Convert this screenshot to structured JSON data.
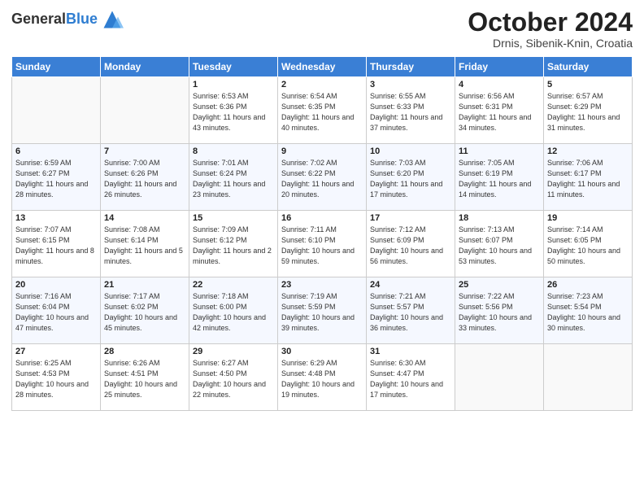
{
  "header": {
    "logo_general": "General",
    "logo_blue": "Blue",
    "month_title": "October 2024",
    "location": "Drnis, Sibenik-Knin, Croatia"
  },
  "days_of_week": [
    "Sunday",
    "Monday",
    "Tuesday",
    "Wednesday",
    "Thursday",
    "Friday",
    "Saturday"
  ],
  "weeks": [
    [
      {
        "day": "",
        "info": ""
      },
      {
        "day": "",
        "info": ""
      },
      {
        "day": "1",
        "info": "Sunrise: 6:53 AM\nSunset: 6:36 PM\nDaylight: 11 hours and 43 minutes."
      },
      {
        "day": "2",
        "info": "Sunrise: 6:54 AM\nSunset: 6:35 PM\nDaylight: 11 hours and 40 minutes."
      },
      {
        "day": "3",
        "info": "Sunrise: 6:55 AM\nSunset: 6:33 PM\nDaylight: 11 hours and 37 minutes."
      },
      {
        "day": "4",
        "info": "Sunrise: 6:56 AM\nSunset: 6:31 PM\nDaylight: 11 hours and 34 minutes."
      },
      {
        "day": "5",
        "info": "Sunrise: 6:57 AM\nSunset: 6:29 PM\nDaylight: 11 hours and 31 minutes."
      }
    ],
    [
      {
        "day": "6",
        "info": "Sunrise: 6:59 AM\nSunset: 6:27 PM\nDaylight: 11 hours and 28 minutes."
      },
      {
        "day": "7",
        "info": "Sunrise: 7:00 AM\nSunset: 6:26 PM\nDaylight: 11 hours and 26 minutes."
      },
      {
        "day": "8",
        "info": "Sunrise: 7:01 AM\nSunset: 6:24 PM\nDaylight: 11 hours and 23 minutes."
      },
      {
        "day": "9",
        "info": "Sunrise: 7:02 AM\nSunset: 6:22 PM\nDaylight: 11 hours and 20 minutes."
      },
      {
        "day": "10",
        "info": "Sunrise: 7:03 AM\nSunset: 6:20 PM\nDaylight: 11 hours and 17 minutes."
      },
      {
        "day": "11",
        "info": "Sunrise: 7:05 AM\nSunset: 6:19 PM\nDaylight: 11 hours and 14 minutes."
      },
      {
        "day": "12",
        "info": "Sunrise: 7:06 AM\nSunset: 6:17 PM\nDaylight: 11 hours and 11 minutes."
      }
    ],
    [
      {
        "day": "13",
        "info": "Sunrise: 7:07 AM\nSunset: 6:15 PM\nDaylight: 11 hours and 8 minutes."
      },
      {
        "day": "14",
        "info": "Sunrise: 7:08 AM\nSunset: 6:14 PM\nDaylight: 11 hours and 5 minutes."
      },
      {
        "day": "15",
        "info": "Sunrise: 7:09 AM\nSunset: 6:12 PM\nDaylight: 11 hours and 2 minutes."
      },
      {
        "day": "16",
        "info": "Sunrise: 7:11 AM\nSunset: 6:10 PM\nDaylight: 10 hours and 59 minutes."
      },
      {
        "day": "17",
        "info": "Sunrise: 7:12 AM\nSunset: 6:09 PM\nDaylight: 10 hours and 56 minutes."
      },
      {
        "day": "18",
        "info": "Sunrise: 7:13 AM\nSunset: 6:07 PM\nDaylight: 10 hours and 53 minutes."
      },
      {
        "day": "19",
        "info": "Sunrise: 7:14 AM\nSunset: 6:05 PM\nDaylight: 10 hours and 50 minutes."
      }
    ],
    [
      {
        "day": "20",
        "info": "Sunrise: 7:16 AM\nSunset: 6:04 PM\nDaylight: 10 hours and 47 minutes."
      },
      {
        "day": "21",
        "info": "Sunrise: 7:17 AM\nSunset: 6:02 PM\nDaylight: 10 hours and 45 minutes."
      },
      {
        "day": "22",
        "info": "Sunrise: 7:18 AM\nSunset: 6:00 PM\nDaylight: 10 hours and 42 minutes."
      },
      {
        "day": "23",
        "info": "Sunrise: 7:19 AM\nSunset: 5:59 PM\nDaylight: 10 hours and 39 minutes."
      },
      {
        "day": "24",
        "info": "Sunrise: 7:21 AM\nSunset: 5:57 PM\nDaylight: 10 hours and 36 minutes."
      },
      {
        "day": "25",
        "info": "Sunrise: 7:22 AM\nSunset: 5:56 PM\nDaylight: 10 hours and 33 minutes."
      },
      {
        "day": "26",
        "info": "Sunrise: 7:23 AM\nSunset: 5:54 PM\nDaylight: 10 hours and 30 minutes."
      }
    ],
    [
      {
        "day": "27",
        "info": "Sunrise: 6:25 AM\nSunset: 4:53 PM\nDaylight: 10 hours and 28 minutes."
      },
      {
        "day": "28",
        "info": "Sunrise: 6:26 AM\nSunset: 4:51 PM\nDaylight: 10 hours and 25 minutes."
      },
      {
        "day": "29",
        "info": "Sunrise: 6:27 AM\nSunset: 4:50 PM\nDaylight: 10 hours and 22 minutes."
      },
      {
        "day": "30",
        "info": "Sunrise: 6:29 AM\nSunset: 4:48 PM\nDaylight: 10 hours and 19 minutes."
      },
      {
        "day": "31",
        "info": "Sunrise: 6:30 AM\nSunset: 4:47 PM\nDaylight: 10 hours and 17 minutes."
      },
      {
        "day": "",
        "info": ""
      },
      {
        "day": "",
        "info": ""
      }
    ]
  ]
}
